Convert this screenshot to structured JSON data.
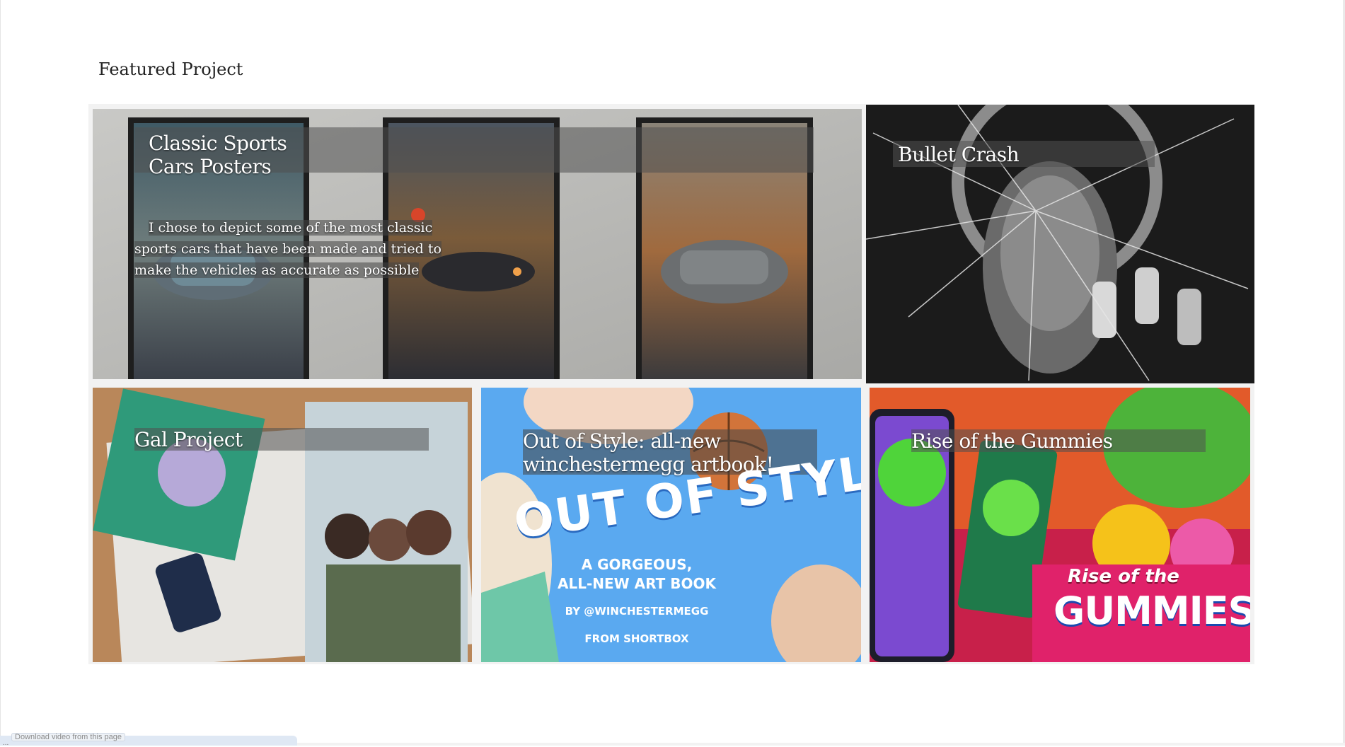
{
  "section": {
    "title": "Featured Project"
  },
  "cards": [
    {
      "title": "Classic Sports\nCars Posters",
      "description": "I chose to depict some of the most classic sports cars that have been made and tried to make the vehicles as accurate as possible",
      "image": "three framed car posters on a concrete wall"
    },
    {
      "title": "Bullet Crash",
      "image": "black and white collage of a face behind shattered glass"
    },
    {
      "title": "Gal Project",
      "image": "gal-dem zine, stickers and cards on a wooden table"
    },
    {
      "title": "Out of Style: all-new winchestermegg artbook!",
      "image": "blue art book cover illustration",
      "cover_text": {
        "headline": "OUT OF STYLE",
        "line1": "A GORGEOUS,",
        "line2": "ALL-NEW ART BOOK",
        "byline": "BY @WINCHESTERMEGG",
        "publisher": "FROM SHORTBOX"
      }
    },
    {
      "title": "Rise of the Gummies",
      "image": "mobile game key art with gummy characters",
      "logo_text": {
        "line1": "Rise of the",
        "line2": "GUMMIES!"
      }
    }
  ],
  "colors": {
    "title_band": "#505050",
    "card4_background": "#5aa9f0",
    "card5_background": "#c8204a"
  },
  "status": {
    "chip": "Download video from this page",
    "text": "..."
  }
}
